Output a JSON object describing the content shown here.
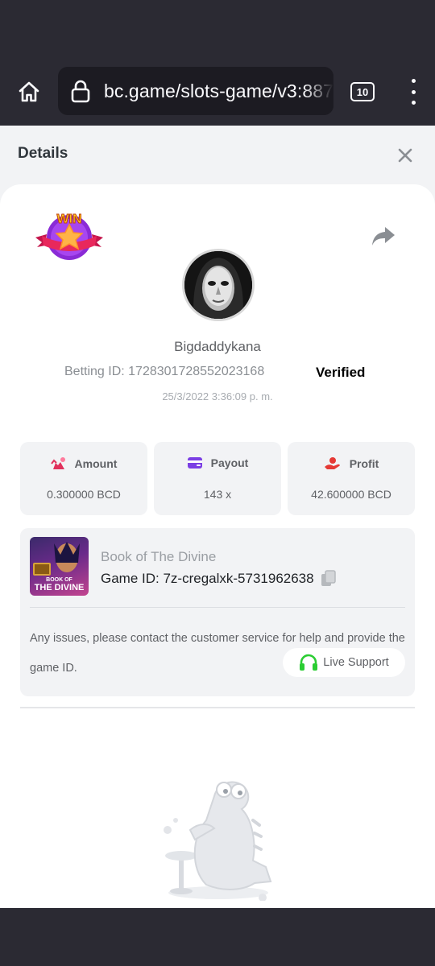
{
  "browser": {
    "url": "bc.game/slots-game/v3:887",
    "tab_count": "10"
  },
  "sheet": {
    "title": "Details"
  },
  "bet": {
    "badge_text": "WIN",
    "username": "Bigdaddykana",
    "betting_id": "Betting ID: 1728301728552023168",
    "verified_label": "Verified",
    "datetime": "25/3/2022 3:36:09 p. m."
  },
  "stats": {
    "amount": {
      "label": "Amount",
      "value": "0.300000 BCD"
    },
    "payout": {
      "label": "Payout",
      "value": "143 x"
    },
    "profit": {
      "label": "Profit",
      "value": "42.600000 BCD"
    }
  },
  "game": {
    "thumb_line1": "BOOK OF",
    "thumb_line2": "THE DIVINE",
    "name": "Book of The Divine",
    "game_id": "Game ID: 7z-cregalxk-5731962638",
    "issue_text": "Any issues, please contact the customer service for help and provide the game ID.",
    "live_support_label": "Live Support"
  },
  "colors": {
    "accent_green": "#2bcd33",
    "amount_icon": "#e0315c",
    "payout_icon": "#7b3fe4",
    "profit_icon": "#e53935"
  },
  "icons": [
    "home-icon",
    "lock-icon",
    "tabs-icon",
    "menu-icon",
    "close-icon",
    "share-icon",
    "copy-icon",
    "headset-icon",
    "mascot-illustration"
  ]
}
